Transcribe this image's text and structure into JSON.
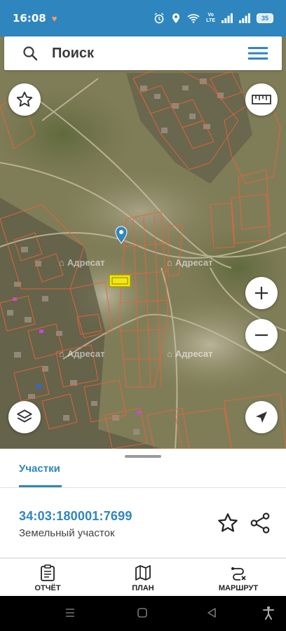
{
  "status_bar": {
    "time": "16:08",
    "volte_line1": "Vo",
    "volte_line2": "LTE",
    "battery": "35"
  },
  "search": {
    "placeholder": "Поиск",
    "icons": [
      "search-icon",
      "menu-icon"
    ]
  },
  "map": {
    "watermark": "Адресат",
    "controls": [
      "star-icon",
      "ruler-icon",
      "zoom-in-icon",
      "zoom-out-icon",
      "layers-icon",
      "navigation-arrow-icon"
    ],
    "colors": {
      "parcel_outline": "#e8643c",
      "selected_parcel": "#f4e614",
      "pin": "#2f86bf"
    }
  },
  "panel": {
    "tab": "Участки",
    "parcel_id": "34:03:180001:7699",
    "parcel_type": "Земельный участок",
    "icons": [
      "star-outline-icon",
      "share-icon"
    ]
  },
  "bottom_nav": {
    "items": [
      {
        "label": "ОТЧЁТ",
        "icon": "report-icon"
      },
      {
        "label": "ПЛАН",
        "icon": "map-plan-icon"
      },
      {
        "label": "МАРШРУТ",
        "icon": "route-icon"
      }
    ]
  },
  "accent_color": "#2f86bf"
}
